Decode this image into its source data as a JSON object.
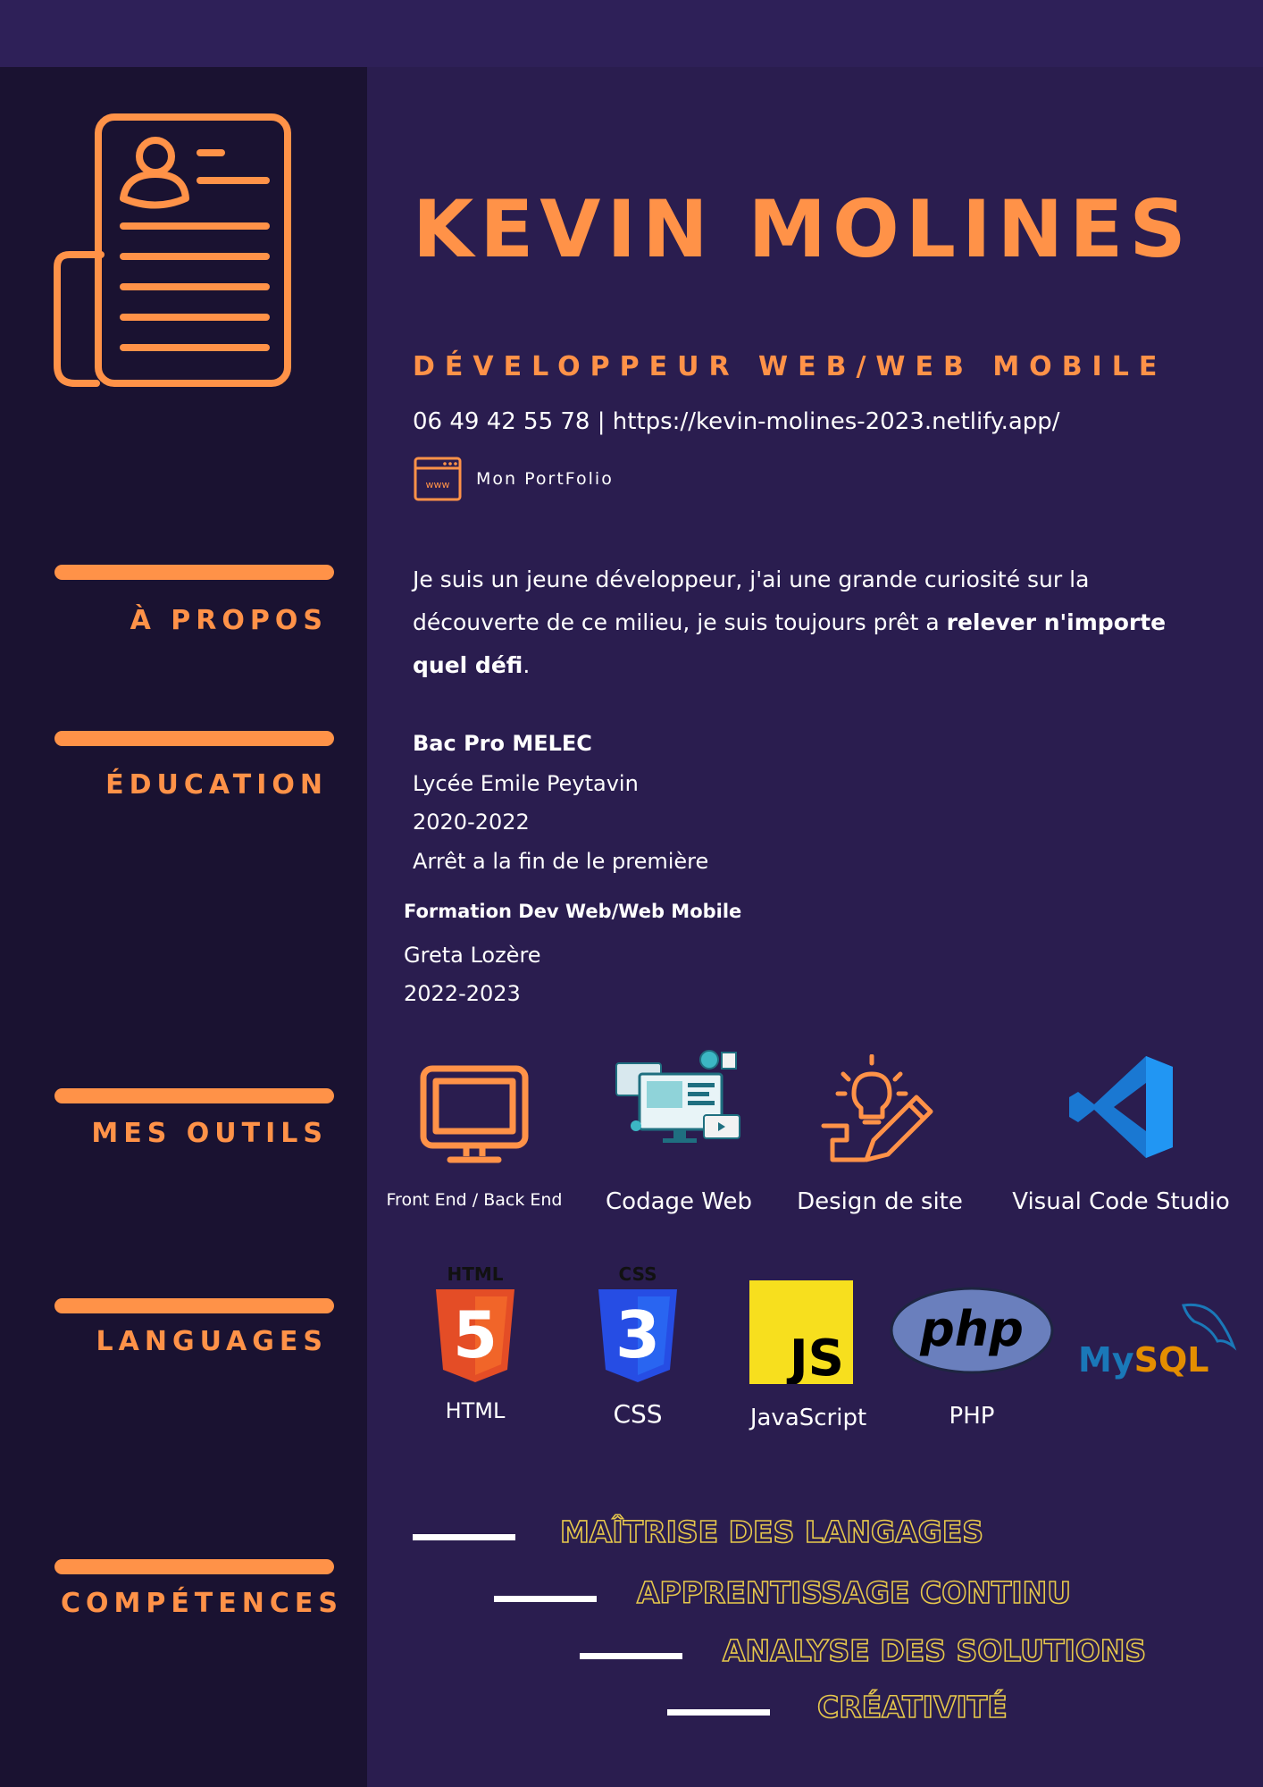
{
  "header": {
    "name": "KEVIN MOLINES",
    "role": "DÉVELOPPEUR WEB/WEB MOBILE",
    "contact": "06 49 42 55 78 | https://kevin-molines-2023.netlify.app/",
    "portfolio_label": "Mon PortFolio",
    "portfolio_icon_text": "www"
  },
  "sections": {
    "about": "À PROPOS",
    "education": "ÉDUCATION",
    "tools": "MES OUTILS",
    "languages": "LANGUAGES",
    "skills": "COMPÉTENCES"
  },
  "about": {
    "text_before": "Je suis un jeune développeur, j'ai une grande curiosité sur la découverte de ce milieu, je suis toujours prêt a ",
    "text_bold": "relever n'importe quel défi",
    "text_after": "."
  },
  "education": [
    {
      "title": "Bac Pro MELEC",
      "school": "Lycée Emile Peytavin",
      "years": "2020-2022",
      "note": "Arrêt a la fin de le première"
    },
    {
      "title": "Formation Dev Web/Web Mobile",
      "school": "Greta Lozère",
      "years": "2022-2023"
    }
  ],
  "tools": [
    {
      "label": "Front End / Back End",
      "icon": "monitor-icon"
    },
    {
      "label": "Codage Web",
      "icon": "web-coding-icon"
    },
    {
      "label": "Design de site",
      "icon": "design-pencil-icon"
    },
    {
      "label": "Visual Code Studio",
      "icon": "vscode-icon"
    }
  ],
  "languages": [
    {
      "label": "HTML",
      "badge": "HTML",
      "digit": "5",
      "icon": "html5-icon"
    },
    {
      "label": "CSS",
      "badge": "CSS",
      "digit": "3",
      "icon": "css3-icon"
    },
    {
      "label": "JavaScript",
      "badge": "JS",
      "icon": "javascript-icon"
    },
    {
      "label": "PHP",
      "badge": "php",
      "icon": "php-icon"
    },
    {
      "label": "",
      "badge": "MySQL",
      "icon": "mysql-icon"
    }
  ],
  "skills": [
    "MAÎTRISE DES LANGAGES",
    "APPRENTISSAGE CONTINU",
    "ANALYSE DES SOLUTIONS",
    "CRÉATIVITÉ"
  ],
  "colors": {
    "background": "#2a1d4f",
    "sidebar": "#1a1231",
    "accent": "#ff9248",
    "skill_outline": "#e6c74c"
  }
}
